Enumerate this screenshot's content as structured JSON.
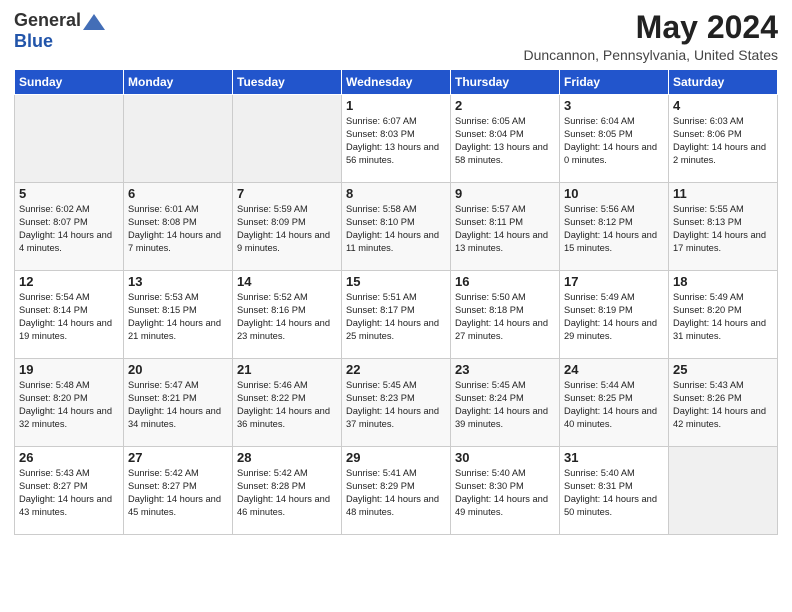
{
  "header": {
    "logo_general": "General",
    "logo_blue": "Blue",
    "month_title": "May 2024",
    "location": "Duncannon, Pennsylvania, United States"
  },
  "days_of_week": [
    "Sunday",
    "Monday",
    "Tuesday",
    "Wednesday",
    "Thursday",
    "Friday",
    "Saturday"
  ],
  "weeks": [
    [
      {
        "day": "",
        "sunrise": "",
        "sunset": "",
        "daylight": "",
        "empty": true
      },
      {
        "day": "",
        "sunrise": "",
        "sunset": "",
        "daylight": "",
        "empty": true
      },
      {
        "day": "",
        "sunrise": "",
        "sunset": "",
        "daylight": "",
        "empty": true
      },
      {
        "day": "1",
        "sunrise": "Sunrise: 6:07 AM",
        "sunset": "Sunset: 8:03 PM",
        "daylight": "Daylight: 13 hours and 56 minutes.",
        "empty": false
      },
      {
        "day": "2",
        "sunrise": "Sunrise: 6:05 AM",
        "sunset": "Sunset: 8:04 PM",
        "daylight": "Daylight: 13 hours and 58 minutes.",
        "empty": false
      },
      {
        "day": "3",
        "sunrise": "Sunrise: 6:04 AM",
        "sunset": "Sunset: 8:05 PM",
        "daylight": "Daylight: 14 hours and 0 minutes.",
        "empty": false
      },
      {
        "day": "4",
        "sunrise": "Sunrise: 6:03 AM",
        "sunset": "Sunset: 8:06 PM",
        "daylight": "Daylight: 14 hours and 2 minutes.",
        "empty": false
      }
    ],
    [
      {
        "day": "5",
        "sunrise": "Sunrise: 6:02 AM",
        "sunset": "Sunset: 8:07 PM",
        "daylight": "Daylight: 14 hours and 4 minutes.",
        "empty": false
      },
      {
        "day": "6",
        "sunrise": "Sunrise: 6:01 AM",
        "sunset": "Sunset: 8:08 PM",
        "daylight": "Daylight: 14 hours and 7 minutes.",
        "empty": false
      },
      {
        "day": "7",
        "sunrise": "Sunrise: 5:59 AM",
        "sunset": "Sunset: 8:09 PM",
        "daylight": "Daylight: 14 hours and 9 minutes.",
        "empty": false
      },
      {
        "day": "8",
        "sunrise": "Sunrise: 5:58 AM",
        "sunset": "Sunset: 8:10 PM",
        "daylight": "Daylight: 14 hours and 11 minutes.",
        "empty": false
      },
      {
        "day": "9",
        "sunrise": "Sunrise: 5:57 AM",
        "sunset": "Sunset: 8:11 PM",
        "daylight": "Daylight: 14 hours and 13 minutes.",
        "empty": false
      },
      {
        "day": "10",
        "sunrise": "Sunrise: 5:56 AM",
        "sunset": "Sunset: 8:12 PM",
        "daylight": "Daylight: 14 hours and 15 minutes.",
        "empty": false
      },
      {
        "day": "11",
        "sunrise": "Sunrise: 5:55 AM",
        "sunset": "Sunset: 8:13 PM",
        "daylight": "Daylight: 14 hours and 17 minutes.",
        "empty": false
      }
    ],
    [
      {
        "day": "12",
        "sunrise": "Sunrise: 5:54 AM",
        "sunset": "Sunset: 8:14 PM",
        "daylight": "Daylight: 14 hours and 19 minutes.",
        "empty": false
      },
      {
        "day": "13",
        "sunrise": "Sunrise: 5:53 AM",
        "sunset": "Sunset: 8:15 PM",
        "daylight": "Daylight: 14 hours and 21 minutes.",
        "empty": false
      },
      {
        "day": "14",
        "sunrise": "Sunrise: 5:52 AM",
        "sunset": "Sunset: 8:16 PM",
        "daylight": "Daylight: 14 hours and 23 minutes.",
        "empty": false
      },
      {
        "day": "15",
        "sunrise": "Sunrise: 5:51 AM",
        "sunset": "Sunset: 8:17 PM",
        "daylight": "Daylight: 14 hours and 25 minutes.",
        "empty": false
      },
      {
        "day": "16",
        "sunrise": "Sunrise: 5:50 AM",
        "sunset": "Sunset: 8:18 PM",
        "daylight": "Daylight: 14 hours and 27 minutes.",
        "empty": false
      },
      {
        "day": "17",
        "sunrise": "Sunrise: 5:49 AM",
        "sunset": "Sunset: 8:19 PM",
        "daylight": "Daylight: 14 hours and 29 minutes.",
        "empty": false
      },
      {
        "day": "18",
        "sunrise": "Sunrise: 5:49 AM",
        "sunset": "Sunset: 8:20 PM",
        "daylight": "Daylight: 14 hours and 31 minutes.",
        "empty": false
      }
    ],
    [
      {
        "day": "19",
        "sunrise": "Sunrise: 5:48 AM",
        "sunset": "Sunset: 8:20 PM",
        "daylight": "Daylight: 14 hours and 32 minutes.",
        "empty": false
      },
      {
        "day": "20",
        "sunrise": "Sunrise: 5:47 AM",
        "sunset": "Sunset: 8:21 PM",
        "daylight": "Daylight: 14 hours and 34 minutes.",
        "empty": false
      },
      {
        "day": "21",
        "sunrise": "Sunrise: 5:46 AM",
        "sunset": "Sunset: 8:22 PM",
        "daylight": "Daylight: 14 hours and 36 minutes.",
        "empty": false
      },
      {
        "day": "22",
        "sunrise": "Sunrise: 5:45 AM",
        "sunset": "Sunset: 8:23 PM",
        "daylight": "Daylight: 14 hours and 37 minutes.",
        "empty": false
      },
      {
        "day": "23",
        "sunrise": "Sunrise: 5:45 AM",
        "sunset": "Sunset: 8:24 PM",
        "daylight": "Daylight: 14 hours and 39 minutes.",
        "empty": false
      },
      {
        "day": "24",
        "sunrise": "Sunrise: 5:44 AM",
        "sunset": "Sunset: 8:25 PM",
        "daylight": "Daylight: 14 hours and 40 minutes.",
        "empty": false
      },
      {
        "day": "25",
        "sunrise": "Sunrise: 5:43 AM",
        "sunset": "Sunset: 8:26 PM",
        "daylight": "Daylight: 14 hours and 42 minutes.",
        "empty": false
      }
    ],
    [
      {
        "day": "26",
        "sunrise": "Sunrise: 5:43 AM",
        "sunset": "Sunset: 8:27 PM",
        "daylight": "Daylight: 14 hours and 43 minutes.",
        "empty": false
      },
      {
        "day": "27",
        "sunrise": "Sunrise: 5:42 AM",
        "sunset": "Sunset: 8:27 PM",
        "daylight": "Daylight: 14 hours and 45 minutes.",
        "empty": false
      },
      {
        "day": "28",
        "sunrise": "Sunrise: 5:42 AM",
        "sunset": "Sunset: 8:28 PM",
        "daylight": "Daylight: 14 hours and 46 minutes.",
        "empty": false
      },
      {
        "day": "29",
        "sunrise": "Sunrise: 5:41 AM",
        "sunset": "Sunset: 8:29 PM",
        "daylight": "Daylight: 14 hours and 48 minutes.",
        "empty": false
      },
      {
        "day": "30",
        "sunrise": "Sunrise: 5:40 AM",
        "sunset": "Sunset: 8:30 PM",
        "daylight": "Daylight: 14 hours and 49 minutes.",
        "empty": false
      },
      {
        "day": "31",
        "sunrise": "Sunrise: 5:40 AM",
        "sunset": "Sunset: 8:31 PM",
        "daylight": "Daylight: 14 hours and 50 minutes.",
        "empty": false
      },
      {
        "day": "",
        "sunrise": "",
        "sunset": "",
        "daylight": "",
        "empty": true
      }
    ]
  ]
}
